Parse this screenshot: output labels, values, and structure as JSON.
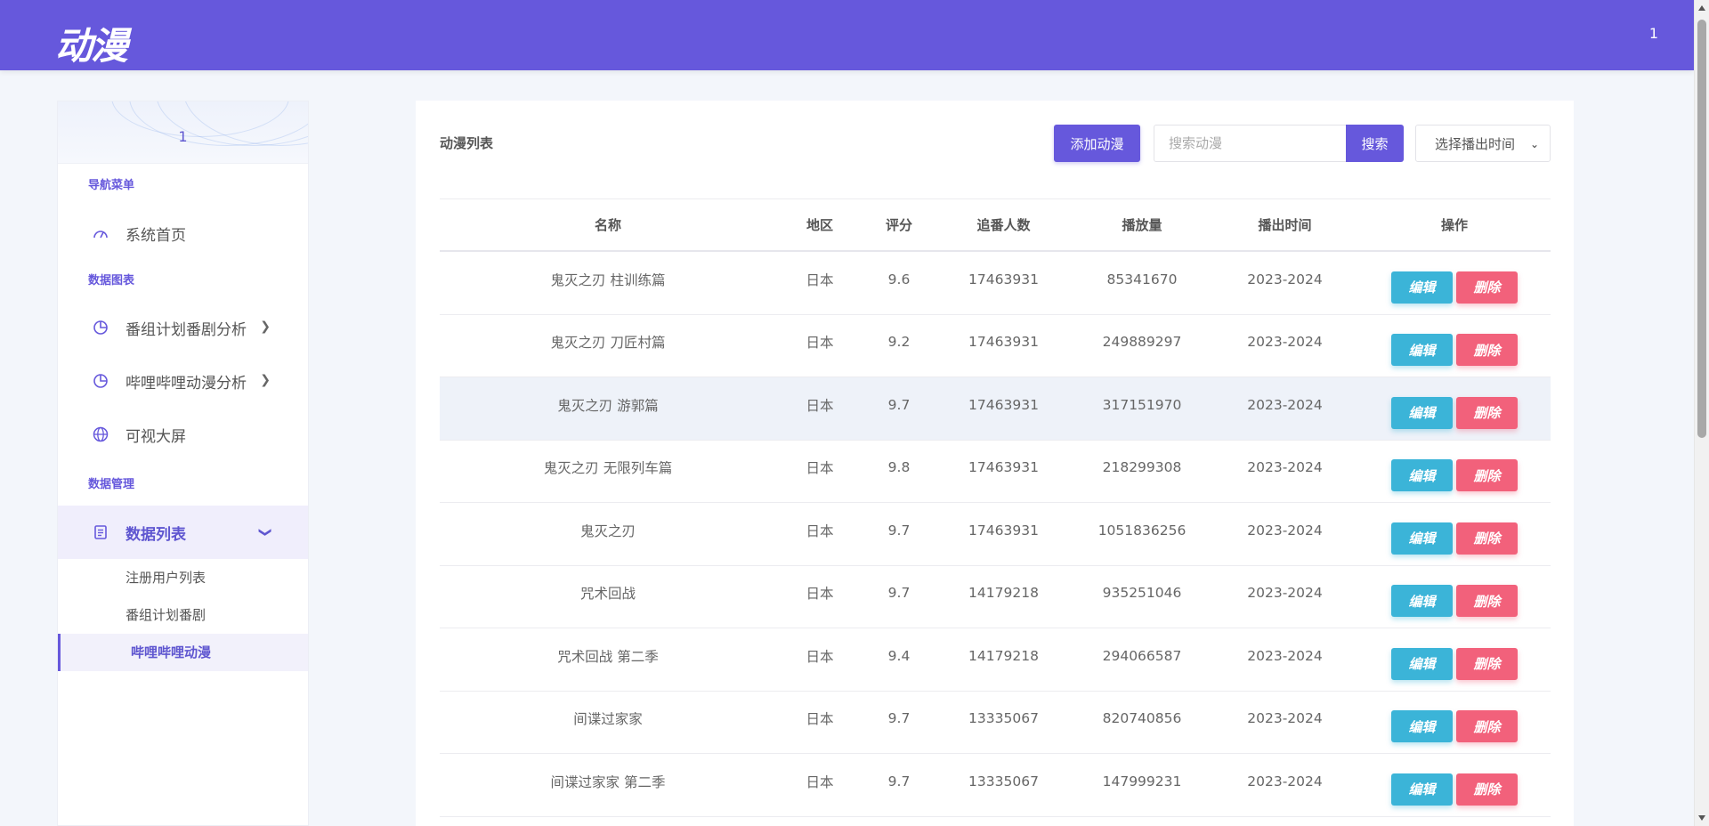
{
  "header": {
    "logo": "动漫",
    "user": "1"
  },
  "sidebar": {
    "profile_name": "1",
    "sections": {
      "nav": "导航菜单",
      "charts": "数据图表",
      "manage": "数据管理"
    },
    "items": {
      "home": "系统首页",
      "program_analysis": "番组计划番剧分析",
      "bilibili_analysis": "哔哩哔哩动漫分析",
      "big_screen": "可视大屏",
      "data_list": "数据列表"
    },
    "sub_items": [
      "注册用户列表",
      "番组计划番剧",
      "哔哩哔哩动漫"
    ]
  },
  "main": {
    "title": "动漫列表",
    "add_button": "添加动漫",
    "search_placeholder": "搜索动漫",
    "search_button": "搜索",
    "time_select": "选择播出时间",
    "columns": [
      "名称",
      "地区",
      "评分",
      "追番人数",
      "播放量",
      "播出时间",
      "操作"
    ],
    "edit_label": "编辑",
    "delete_label": "删除",
    "rows": [
      [
        "鬼灭之刃 柱训练篇",
        "日本",
        "9.6",
        "17463931",
        "85341670",
        "2023-2024"
      ],
      [
        "鬼灭之刃 刀匠村篇",
        "日本",
        "9.2",
        "17463931",
        "249889297",
        "2023-2024"
      ],
      [
        "鬼灭之刃 游郭篇",
        "日本",
        "9.7",
        "17463931",
        "317151970",
        "2023-2024"
      ],
      [
        "鬼灭之刃 无限列车篇",
        "日本",
        "9.8",
        "17463931",
        "218299308",
        "2023-2024"
      ],
      [
        "鬼灭之刃",
        "日本",
        "9.7",
        "17463931",
        "1051836256",
        "2023-2024"
      ],
      [
        "咒术回战",
        "日本",
        "9.7",
        "14179218",
        "935251046",
        "2023-2024"
      ],
      [
        "咒术回战 第二季",
        "日本",
        "9.4",
        "14179218",
        "294066587",
        "2023-2024"
      ],
      [
        "间谍过家家",
        "日本",
        "9.7",
        "13335067",
        "820740856",
        "2023-2024"
      ],
      [
        "间谍过家家 第二季",
        "日本",
        "9.7",
        "13335067",
        "147999231",
        "2023-2024"
      ]
    ]
  }
}
